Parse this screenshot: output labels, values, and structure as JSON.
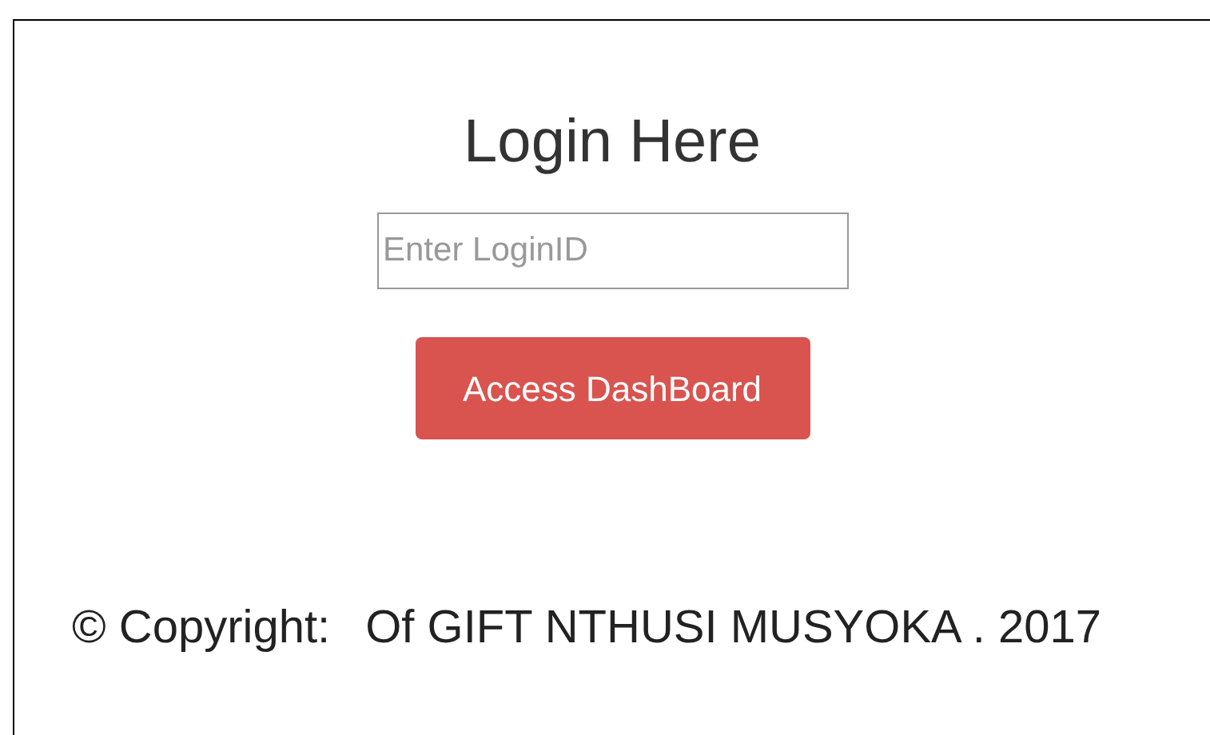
{
  "heading": "Login Here",
  "login_field": {
    "placeholder": "Enter LoginID"
  },
  "button": "Access DashBoard",
  "footer": {
    "label": "© Copyright:",
    "owner": "Of GIFT NTHUSI MUSYOKA . 2017"
  }
}
